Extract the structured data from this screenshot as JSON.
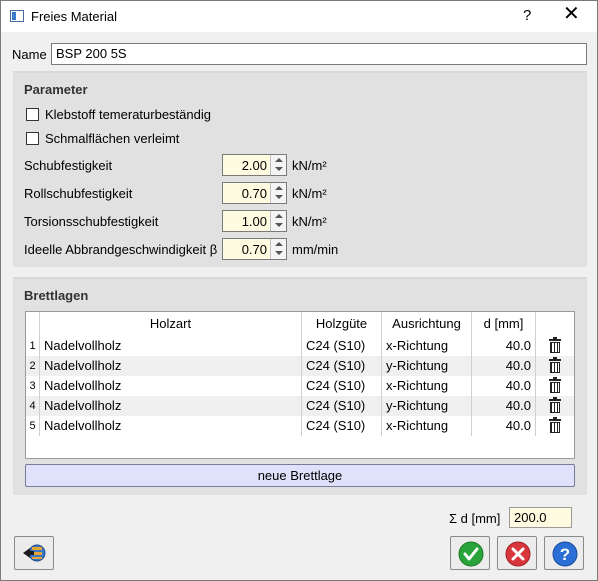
{
  "window": {
    "title": "Freies Material",
    "help_glyph": "?",
    "close_glyph": "✕"
  },
  "name": {
    "label": "Name",
    "value": "BSP 200 5S"
  },
  "parameter": {
    "title": "Parameter",
    "checkboxes": [
      {
        "label": "Klebstoff temeraturbeständig",
        "checked": false
      },
      {
        "label": "Schmalflächen verleimt",
        "checked": false
      }
    ],
    "fields": [
      {
        "label": "Schubfestigkeit",
        "value": "2.00",
        "unit": "kN/m²"
      },
      {
        "label": "Rollschubfestigkeit",
        "value": "0.70",
        "unit": "kN/m²"
      },
      {
        "label": "Torsionsschubfestigkeit",
        "value": "1.00",
        "unit": "kN/m²"
      },
      {
        "label": "Ideelle Abbrandgeschwindigkeit β",
        "value": "0.70",
        "unit": "mm/min"
      }
    ]
  },
  "brettlagen": {
    "title": "Brettlagen",
    "columns": [
      "Holzart",
      "Holzgüte",
      "Ausrichtung",
      "d [mm]"
    ],
    "rows": [
      {
        "num": "1",
        "holzart": "Nadelvollholz",
        "gute": "C24 (S10)",
        "ausrichtung": "x-Richtung",
        "d": "40.0"
      },
      {
        "num": "2",
        "holzart": "Nadelvollholz",
        "gute": "C24 (S10)",
        "ausrichtung": "y-Richtung",
        "d": "40.0"
      },
      {
        "num": "3",
        "holzart": "Nadelvollholz",
        "gute": "C24 (S10)",
        "ausrichtung": "x-Richtung",
        "d": "40.0"
      },
      {
        "num": "4",
        "holzart": "Nadelvollholz",
        "gute": "C24 (S10)",
        "ausrichtung": "y-Richtung",
        "d": "40.0"
      },
      {
        "num": "5",
        "holzart": "Nadelvollholz",
        "gute": "C24 (S10)",
        "ausrichtung": "x-Richtung",
        "d": "40.0"
      }
    ],
    "add_button": "neue Brettlage"
  },
  "sum": {
    "label": "Σ d [mm]",
    "value": "200.0"
  },
  "icons": {
    "import": "import-icon",
    "ok": "check-icon",
    "cancel": "cancel-icon",
    "help": "help-icon",
    "delete": "trash-icon"
  },
  "colors": {
    "ok_green": "#2aa43a",
    "cancel_red": "#d8363a",
    "help_blue": "#2b6fd6",
    "input_yellow": "#fffbe0",
    "add_button_bg": "#e0e2fb"
  }
}
